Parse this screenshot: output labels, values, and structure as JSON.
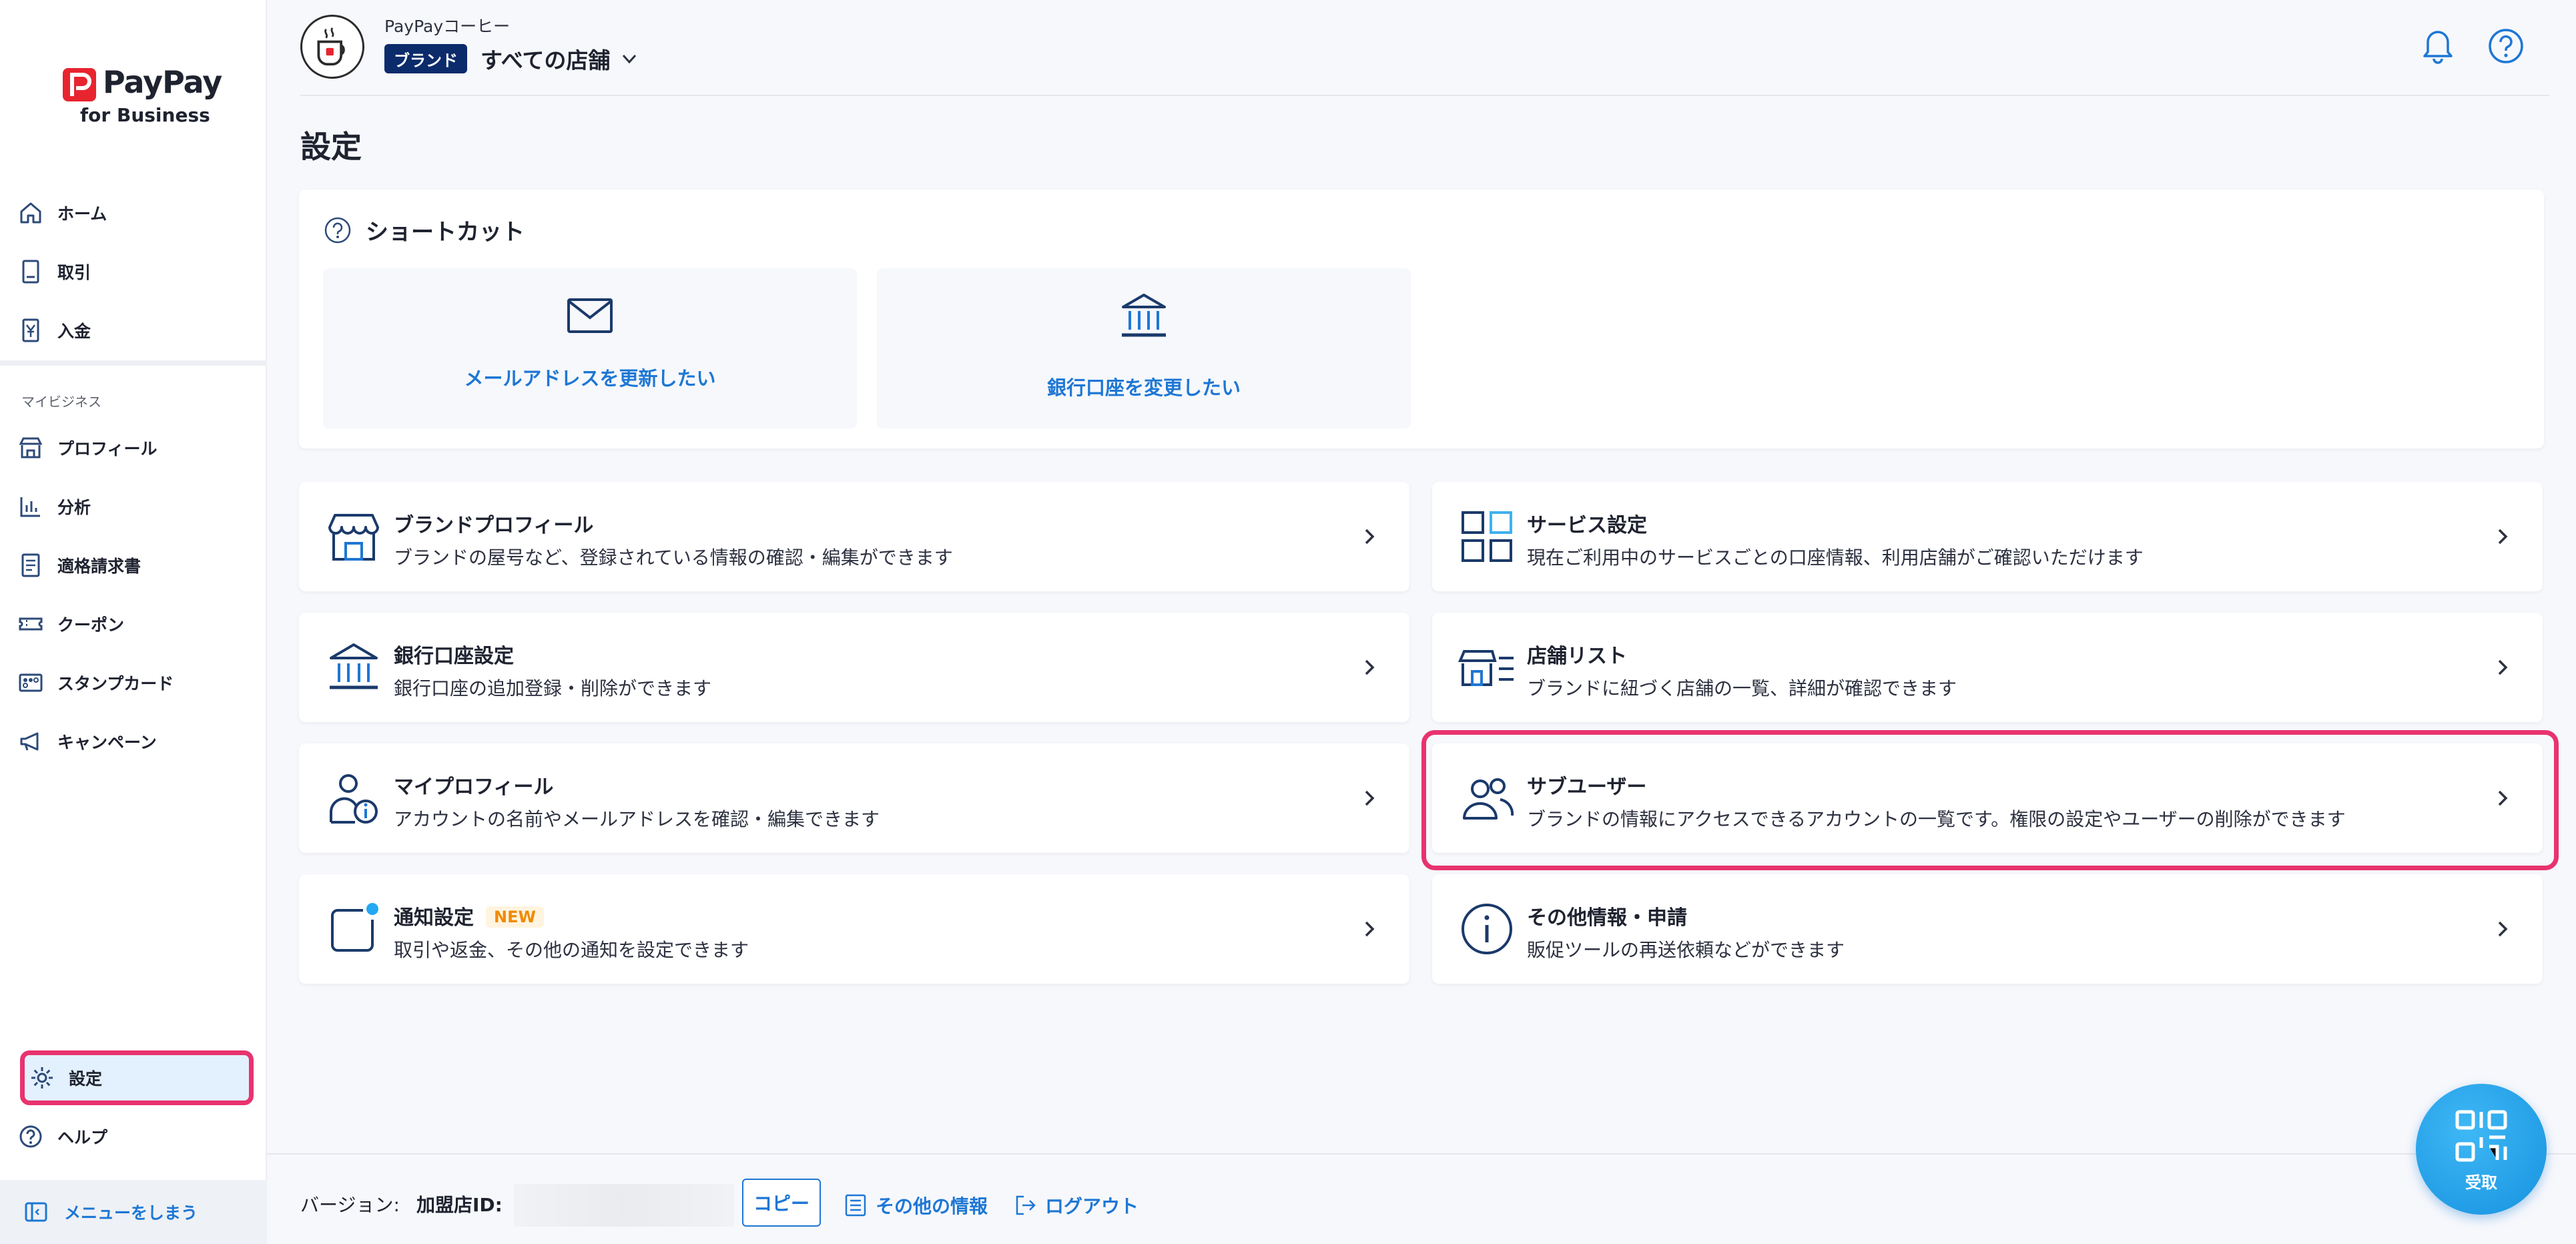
{
  "app": {
    "logo_text": "PayPay",
    "logo_sub": "for Business"
  },
  "sidebar": {
    "top_items": [
      {
        "label": "ホーム",
        "icon": "home-icon"
      },
      {
        "label": "取引",
        "icon": "receipt-icon"
      },
      {
        "label": "入金",
        "icon": "deposit-icon"
      }
    ],
    "section_label": "マイビジネス",
    "business_items": [
      {
        "label": "プロフィール",
        "icon": "storefront-icon"
      },
      {
        "label": "分析",
        "icon": "chart-icon"
      },
      {
        "label": "適格請求書",
        "icon": "invoice-icon"
      },
      {
        "label": "クーポン",
        "icon": "coupon-icon"
      },
      {
        "label": "スタンプカード",
        "icon": "stamp-card-icon"
      },
      {
        "label": "キャンペーン",
        "icon": "megaphone-icon"
      }
    ],
    "settings_label": "設定",
    "help_label": "ヘルプ",
    "collapse_label": "メニューをしまう"
  },
  "header": {
    "store_name": "PayPayコーヒー",
    "brand_badge": "ブランド",
    "store_select": "すべての店舗"
  },
  "page": {
    "title": "設定"
  },
  "shortcuts": {
    "title": "ショートカット",
    "items": [
      {
        "label": "メールアドレスを更新したい",
        "icon": "mail-icon"
      },
      {
        "label": "銀行口座を変更したい",
        "icon": "bank-icon"
      }
    ]
  },
  "cards": [
    {
      "title": "ブランドプロフィール",
      "desc": "ブランドの屋号など、登録されている情報の確認・編集ができます",
      "icon": "storefront-icon"
    },
    {
      "title": "サービス設定",
      "desc": "現在ご利用中のサービスごとの口座情報、利用店舗がご確認いただけます",
      "icon": "grid-icon"
    },
    {
      "title": "銀行口座設定",
      "desc": "銀行口座の追加登録・削除ができます",
      "icon": "bank-icon"
    },
    {
      "title": "店舗リスト",
      "desc": "ブランドに紐づく店舗の一覧、詳細が確認できます",
      "icon": "store-list-icon"
    },
    {
      "title": "マイプロフィール",
      "desc": "アカウントの名前やメールアドレスを確認・編集できます",
      "icon": "user-info-icon"
    },
    {
      "title": "サブユーザー",
      "desc": "ブランドの情報にアクセスできるアカウントの一覧です。権限の設定やユーザーの削除ができます",
      "icon": "users-icon"
    },
    {
      "title": "通知設定",
      "desc": "取引や返金、その他の通知を設定できます",
      "icon": "notification-icon",
      "badge": "NEW"
    },
    {
      "title": "その他情報・申請",
      "desc": "販促ツールの再送依頼などができます",
      "icon": "info-icon"
    }
  ],
  "footer": {
    "version_label": "バージョン:",
    "merchant_id_label": "加盟店ID:",
    "copy_label": "コピー",
    "other_info_label": "その他の情報",
    "logout_label": "ログアウト"
  },
  "fab": {
    "label": "受取"
  },
  "colors": {
    "accent": "#1e77d4",
    "brand_red": "#e8242f",
    "highlight": "#e8336e",
    "badge_navy": "#0b2b6b"
  }
}
